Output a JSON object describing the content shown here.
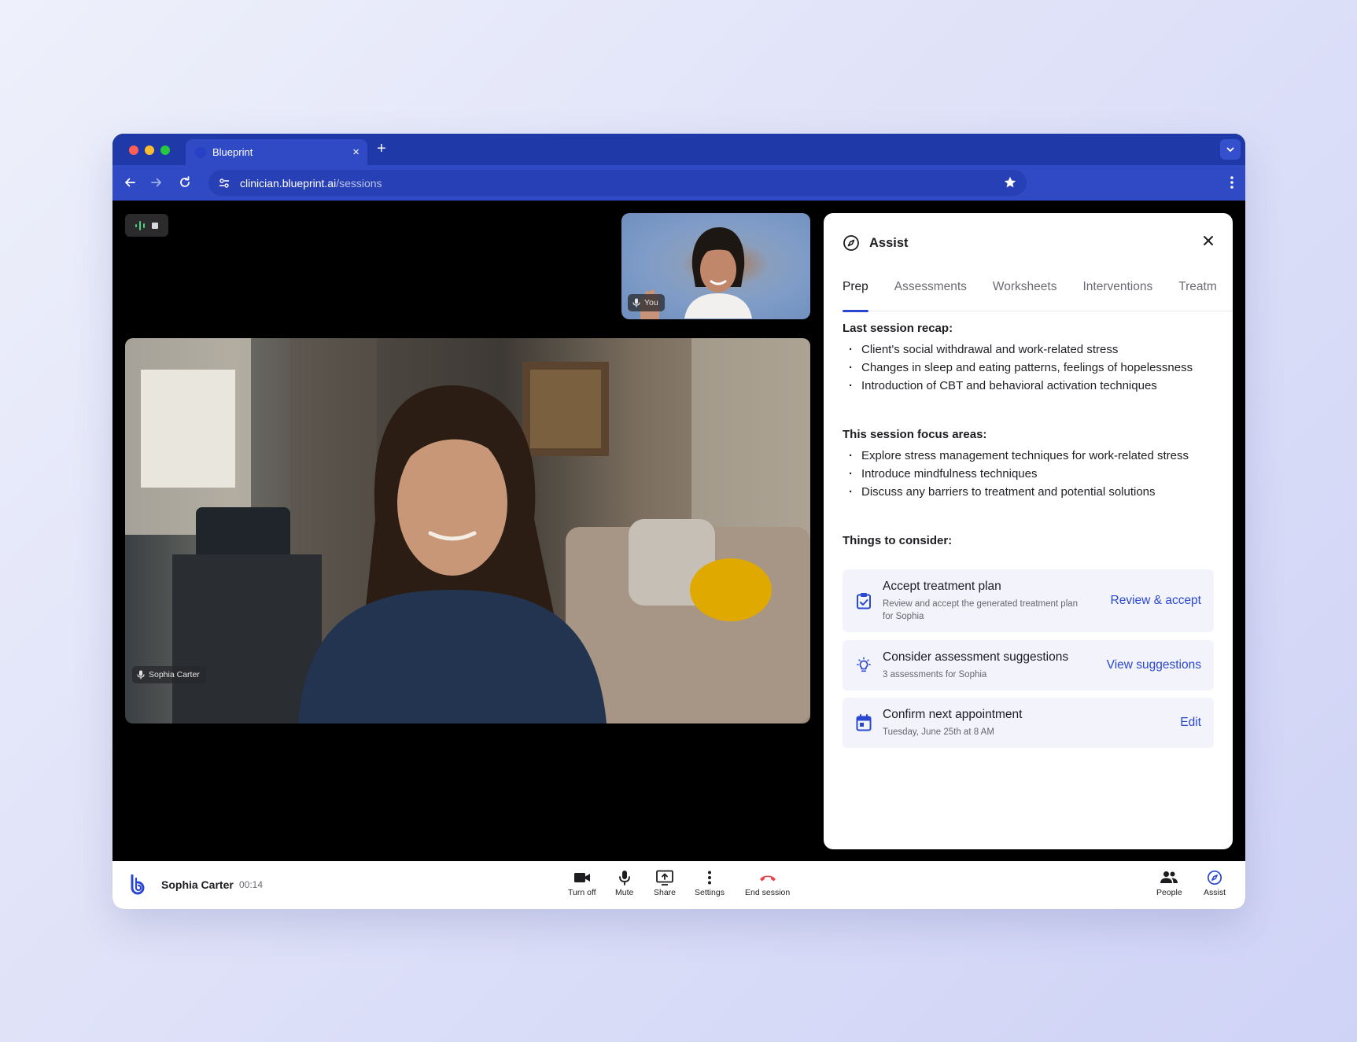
{
  "browser": {
    "tab_title": "Blueprint",
    "new_tab_label": "+",
    "tab_close_label": "×",
    "url_host": "clinician.blueprint.ai",
    "url_path": "/sessions"
  },
  "video": {
    "self_label": "You",
    "client_label": "Sophia Carter"
  },
  "assist": {
    "title": "Assist",
    "tabs": [
      "Prep",
      "Assessments",
      "Worksheets",
      "Interventions",
      "Treatm"
    ],
    "active_tab": "Prep",
    "recap_title": "Last session recap:",
    "recap_items": [
      "Client's social withdrawal and work-related stress",
      "Changes in sleep and eating patterns, feelings of hopelessness",
      "Introduction of CBT and behavioral activation techniques"
    ],
    "focus_title": "This session focus areas:",
    "focus_items": [
      "Explore stress management techniques for work-related stress",
      "Introduce mindfulness techniques",
      "Discuss any barriers to treatment and potential solutions"
    ],
    "consider_title": "Things to consider:",
    "cards": [
      {
        "title": "Accept treatment plan",
        "subtitle": "Review and accept the generated treatment plan for Sophia",
        "action": "Review & accept",
        "icon": "clipboard-check-icon"
      },
      {
        "title": "Consider assessment suggestions",
        "subtitle": "3 assessments for Sophia",
        "action": "View suggestions",
        "icon": "lightbulb-icon"
      },
      {
        "title": "Confirm next appointment",
        "subtitle": "Tuesday, June 25th at 8 AM",
        "action": "Edit",
        "icon": "calendar-icon"
      }
    ]
  },
  "footer": {
    "client_name": "Sophia Carter",
    "elapsed": "00:14",
    "controls": {
      "camera": "Turn off",
      "mute": "Mute",
      "share": "Share",
      "settings": "Settings",
      "end": "End session",
      "people": "People",
      "assist": "Assist"
    }
  },
  "colors": {
    "accent": "#2a47d1",
    "browser_chrome": "#1f3aa8",
    "end_session": "#e5484d",
    "recording_green": "#4cd37a"
  }
}
